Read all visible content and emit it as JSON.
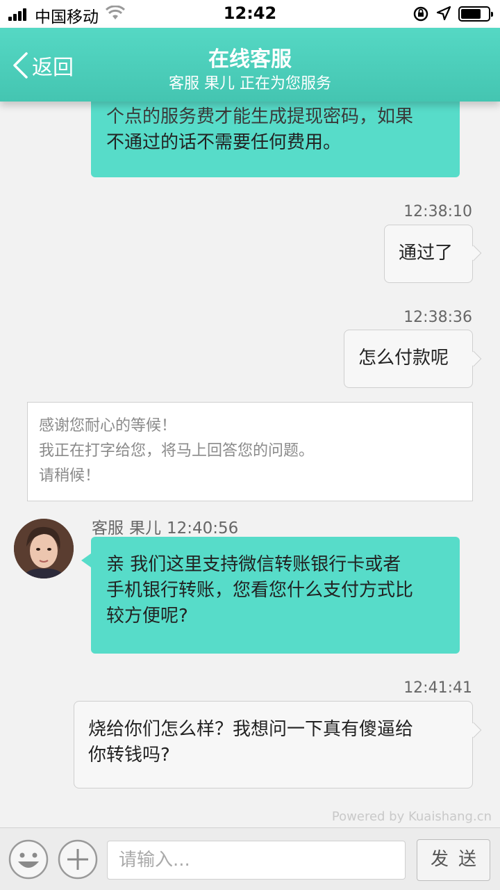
{
  "status_bar": {
    "carrier": "中国移动",
    "time": "12:42"
  },
  "header": {
    "back_label": "返回",
    "title": "在线客服",
    "subtitle": "客服 果儿 正在为您服务"
  },
  "messages": [
    {
      "from": "agent",
      "text_line1": "个点的服务费才能生成提现密码，如果",
      "text_line2": "不通过的话不需要任何费用。"
    },
    {
      "from": "user",
      "time": "12:38:10",
      "text": "通过了"
    },
    {
      "from": "user",
      "time": "12:38:36",
      "text": "怎么付款呢"
    },
    {
      "from": "system",
      "line1": "感谢您耐心的等候！",
      "line2": "我正在打字给您，将马上回答您的问题。",
      "line3": "请稍候！"
    },
    {
      "from": "agent",
      "role": "客服",
      "name": "果儿",
      "time": "12:40:56",
      "line1": "亲 我们这里支持微信转账银行卡或者",
      "line2": "手机银行转账，您看您什么支付方式比",
      "line3": "较方便呢?"
    },
    {
      "from": "user",
      "time": "12:41:41",
      "line1": "烧给你们怎么样？我想问一下真有傻逼给",
      "line2": "你转钱吗?"
    }
  ],
  "powered_by": "Powered by Kuaishang.cn",
  "input_bar": {
    "placeholder": "请输入...",
    "send_label": "发送"
  },
  "colors": {
    "header": "#4fd0bc",
    "agent_bubble": "#57dcc9",
    "user_bubble": "#f7f7f7"
  }
}
